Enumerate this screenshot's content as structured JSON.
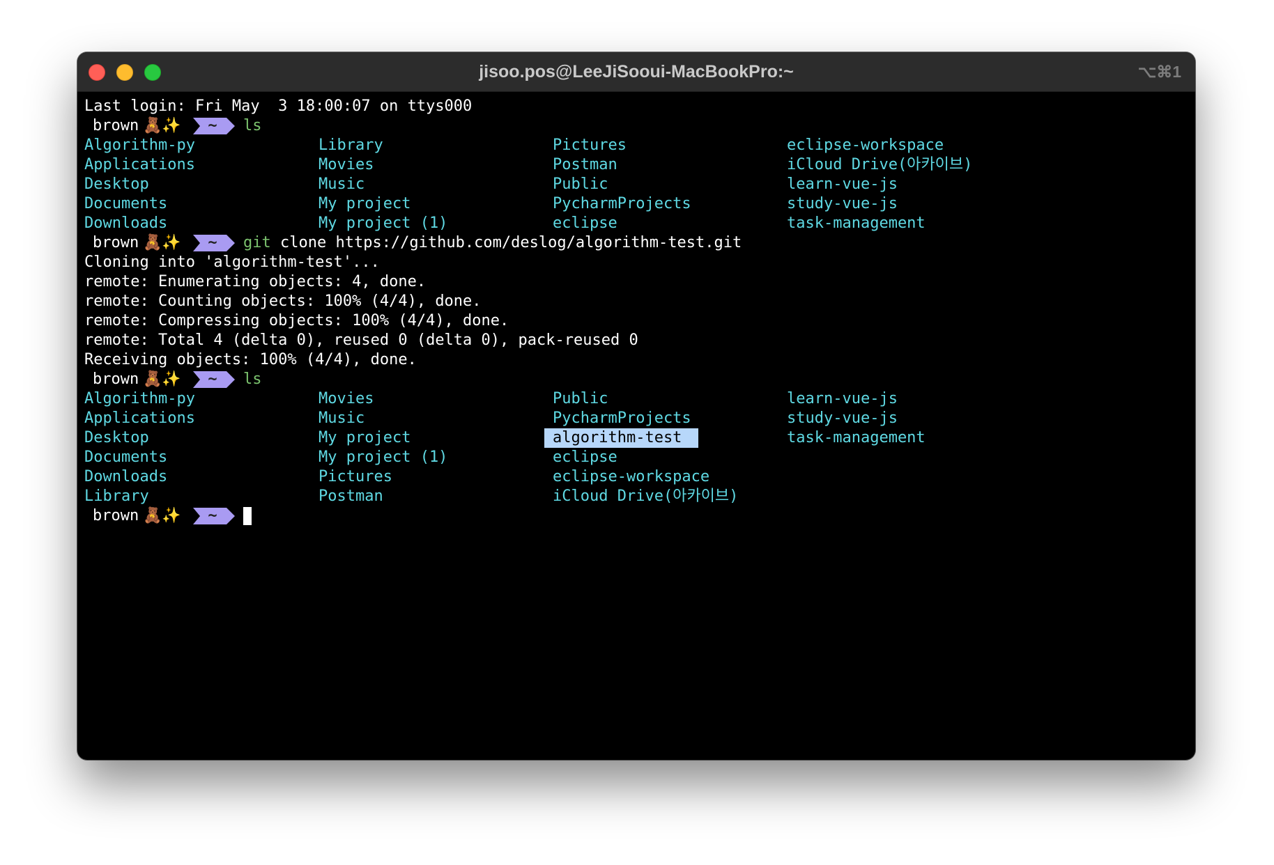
{
  "window": {
    "title": "jisoo.pos@LeeJiSooui-MacBookPro:~",
    "shortcut": "⌥⌘1"
  },
  "prompt": {
    "user": "brown",
    "emoji": "🧸✨",
    "dir": "~"
  },
  "terminal": {
    "last_login": "Last login: Fri May  3 18:00:07 on ttys000",
    "cmd1": {
      "name": "ls",
      "args": ""
    },
    "ls1": {
      "col0": [
        "Algorithm-py",
        "Applications",
        "Desktop",
        "Documents",
        "Downloads"
      ],
      "col1": [
        "Library",
        "Movies",
        "Music",
        "My project",
        "My project (1)"
      ],
      "col2": [
        "Pictures",
        "Postman",
        "Public",
        "PycharmProjects",
        "eclipse"
      ],
      "col3": [
        "eclipse-workspace",
        "iCloud Drive(아카이브)",
        "learn-vue-js",
        "study-vue-js",
        "task-management"
      ]
    },
    "cmd2": {
      "name": "git",
      "args": " clone https://github.com/deslog/algorithm-test.git"
    },
    "clone_output": [
      "Cloning into 'algorithm-test'...",
      "remote: Enumerating objects: 4, done.",
      "remote: Counting objects: 100% (4/4), done.",
      "remote: Compressing objects: 100% (4/4), done.",
      "remote: Total 4 (delta 0), reused 0 (delta 0), pack-reused 0",
      "Receiving objects: 100% (4/4), done."
    ],
    "cmd3": {
      "name": "ls",
      "args": ""
    },
    "ls2": {
      "col0": [
        "Algorithm-py",
        "Applications",
        "Desktop",
        "Documents",
        "Downloads",
        "Library"
      ],
      "col1": [
        "Movies",
        "Music",
        "My project",
        "My project (1)",
        "Pictures",
        "Postman"
      ],
      "col2": [
        "Public",
        "PycharmProjects",
        "algorithm-test",
        "eclipse",
        "eclipse-workspace",
        "iCloud Drive(아카이브)"
      ],
      "col3": [
        "learn-vue-js",
        "study-vue-js",
        "task-management"
      ]
    },
    "selected_item": "algorithm-test"
  },
  "colors": {
    "directory": "#5fd9e3",
    "prompt_segment": "#a99bf2",
    "command": "#7cc36e",
    "selection": "#b7d7fa"
  }
}
